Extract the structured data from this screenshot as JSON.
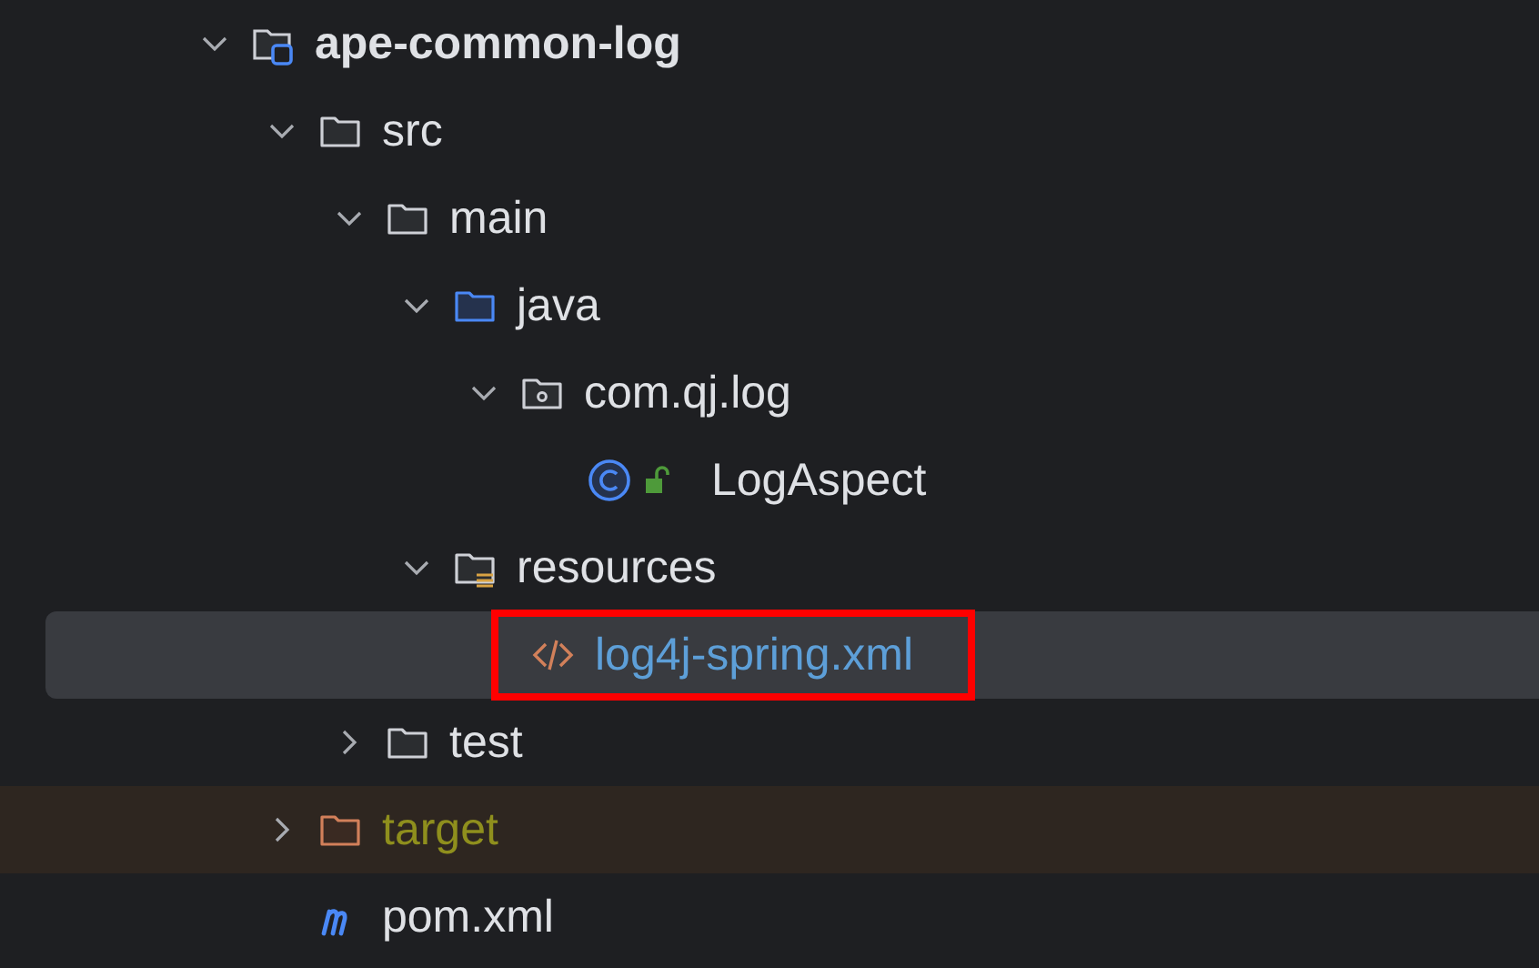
{
  "project_tree": [
    {
      "label": "ape-common-log",
      "kind": "module",
      "expanded": true,
      "selected": false,
      "excluded": false,
      "annotated": false,
      "children": [
        {
          "label": "src",
          "kind": "folder",
          "expanded": true,
          "selected": false,
          "excluded": false,
          "annotated": false,
          "children": [
            {
              "label": "main",
              "kind": "folder",
              "expanded": true,
              "selected": false,
              "excluded": false,
              "annotated": false,
              "children": [
                {
                  "label": "java",
                  "kind": "source-folder",
                  "expanded": true,
                  "selected": false,
                  "excluded": false,
                  "annotated": false,
                  "children": [
                    {
                      "label": "com.qj.log",
                      "kind": "package",
                      "expanded": true,
                      "selected": false,
                      "excluded": false,
                      "annotated": false,
                      "children": [
                        {
                          "label": "LogAspect",
                          "kind": "class",
                          "selected": false,
                          "excluded": false,
                          "annotated": false
                        }
                      ]
                    }
                  ]
                },
                {
                  "label": "resources",
                  "kind": "resources-folder",
                  "expanded": true,
                  "selected": false,
                  "excluded": false,
                  "annotated": false,
                  "children": [
                    {
                      "label": "log4j-spring.xml",
                      "kind": "xml",
                      "selected": true,
                      "excluded": false,
                      "annotated": true
                    }
                  ]
                }
              ]
            },
            {
              "label": "test",
              "kind": "folder",
              "expanded": false,
              "selected": false,
              "excluded": false,
              "annotated": false
            }
          ]
        },
        {
          "label": "target",
          "kind": "excluded-folder",
          "expanded": false,
          "selected": false,
          "excluded": true,
          "annotated": false
        },
        {
          "label": "pom.xml",
          "kind": "maven",
          "selected": false,
          "excluded": false,
          "annotated": false
        }
      ]
    }
  ]
}
